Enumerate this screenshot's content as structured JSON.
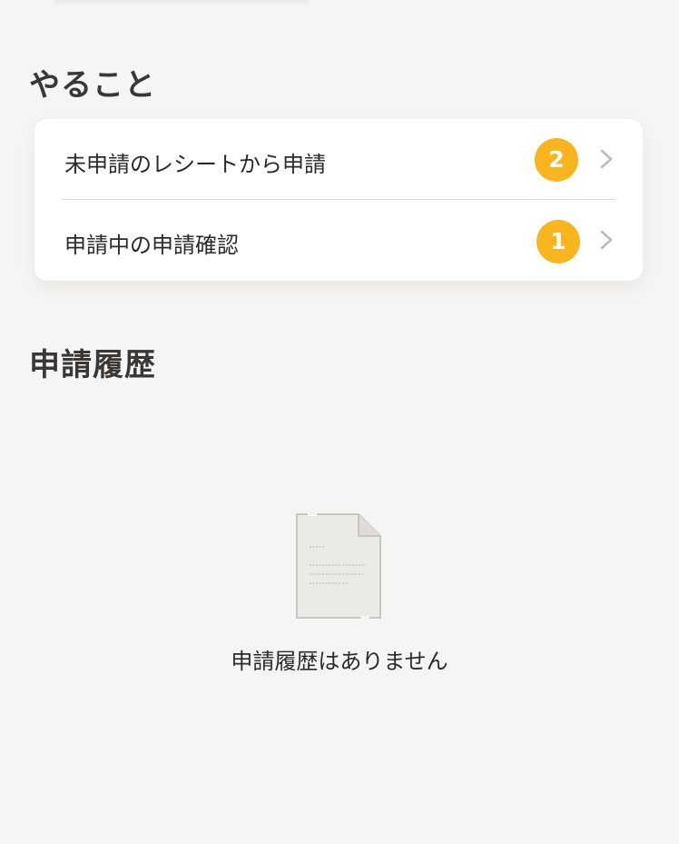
{
  "todo": {
    "title": "やること",
    "items": [
      {
        "label": "未申請のレシートから申請",
        "badge": "2"
      },
      {
        "label": "申請中の申請確認",
        "badge": "1"
      }
    ]
  },
  "history": {
    "title": "申請履歴",
    "empty_message": "申請履歴はありません"
  },
  "colors": {
    "badge": "#f8b51e",
    "background": "#f6f5f3"
  }
}
